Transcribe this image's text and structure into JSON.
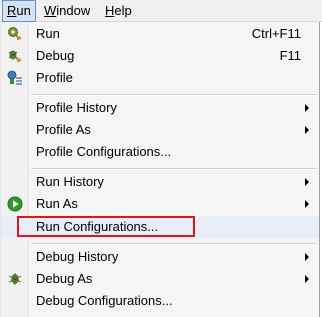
{
  "menubar": {
    "run": {
      "underline": "R",
      "rest": "un"
    },
    "window": {
      "underline": "W",
      "rest": "indow"
    },
    "help": {
      "underline": "H",
      "rest": "elp"
    }
  },
  "menu": {
    "items": [
      {
        "label": "Run",
        "accel": "Ctrl+F11",
        "icon": "run-gear-icon"
      },
      {
        "label": "Debug",
        "accel": "F11",
        "icon": "debug-bug-icon"
      },
      {
        "label": "Profile",
        "icon": "profile-icon"
      },
      {
        "label": "Profile History",
        "submenu": true
      },
      {
        "label": "Profile As",
        "submenu": true
      },
      {
        "label": "Profile Configurations..."
      },
      {
        "label": "Run History",
        "submenu": true
      },
      {
        "label": "Run As",
        "submenu": true,
        "icon": "run-play-icon"
      },
      {
        "label": "Run Configurations...",
        "highlighted": true
      },
      {
        "label": "Debug History",
        "submenu": true
      },
      {
        "label": "Debug As",
        "submenu": true,
        "icon": "debug-bug-icon"
      },
      {
        "label": "Debug Configurations..."
      }
    ]
  },
  "colors": {
    "highlight_box": "#e0141b",
    "run_green": "#2e9b2e"
  }
}
